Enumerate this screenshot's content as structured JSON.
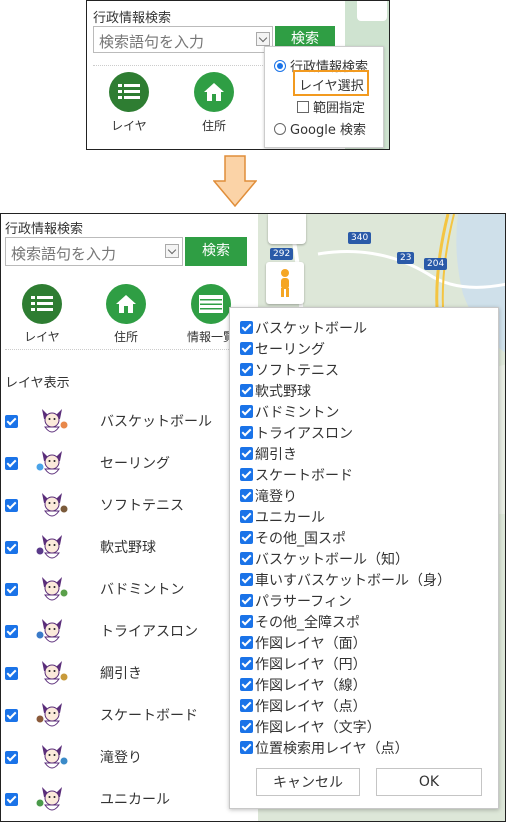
{
  "top_panel": {
    "title": "行政情報検索",
    "search_placeholder": "検索語句を入力",
    "search_button": "検索",
    "icons": [
      {
        "label": "レイヤ",
        "icon": "list-icon"
      },
      {
        "label": "住所",
        "icon": "home-icon"
      }
    ],
    "popup": {
      "options": [
        {
          "label": "行政情報検索",
          "checked": true
        },
        {
          "label": "レイヤ選択",
          "highlighted": true
        },
        {
          "label": "範囲指定",
          "type": "checkbox",
          "checked": false
        },
        {
          "label": "Google 検索",
          "checked": false
        }
      ]
    }
  },
  "bottom_panel": {
    "title": "行政情報検索",
    "search_placeholder": "検索語句を入力",
    "search_button": "検索",
    "icons": [
      {
        "label": "レイヤ",
        "icon": "list-icon"
      },
      {
        "label": "住所",
        "icon": "home-icon"
      },
      {
        "label": "情報一覧",
        "icon": "table-icon"
      }
    ],
    "layer_heading": "レイヤ表示",
    "layers": [
      {
        "label": "バスケットボール",
        "checked": true
      },
      {
        "label": "セーリング",
        "checked": true
      },
      {
        "label": "ソフトテニス",
        "checked": true
      },
      {
        "label": "軟式野球",
        "checked": true
      },
      {
        "label": "バドミントン",
        "checked": true
      },
      {
        "label": "トライアスロン",
        "checked": true
      },
      {
        "label": "綱引き",
        "checked": true
      },
      {
        "label": "スケートボード",
        "checked": true
      },
      {
        "label": "滝登り",
        "checked": true
      },
      {
        "label": "ユニカール",
        "checked": true
      }
    ],
    "map": {
      "road_labels": [
        "340",
        "292",
        "23",
        "204"
      ]
    },
    "dialog": {
      "items": [
        {
          "label": "バスケットボール",
          "checked": true
        },
        {
          "label": "セーリング",
          "checked": true
        },
        {
          "label": "ソフトテニス",
          "checked": true
        },
        {
          "label": "軟式野球",
          "checked": true
        },
        {
          "label": "バドミントン",
          "checked": true
        },
        {
          "label": "トライアスロン",
          "checked": true
        },
        {
          "label": "綱引き",
          "checked": true
        },
        {
          "label": "スケートボード",
          "checked": true
        },
        {
          "label": "滝登り",
          "checked": true
        },
        {
          "label": "ユニカール",
          "checked": true
        },
        {
          "label": "その他_国スポ",
          "checked": true
        },
        {
          "label": "バスケットボール（知）",
          "checked": true
        },
        {
          "label": "車いすバスケットボール（身）",
          "checked": true
        },
        {
          "label": "パラサーフィン",
          "checked": true
        },
        {
          "label": "その他_全障スポ",
          "checked": true
        },
        {
          "label": "作図レイヤ（面）",
          "checked": true
        },
        {
          "label": "作図レイヤ（円）",
          "checked": true
        },
        {
          "label": "作図レイヤ（線）",
          "checked": true
        },
        {
          "label": "作図レイヤ（点）",
          "checked": true
        },
        {
          "label": "作図レイヤ（文字）",
          "checked": true
        },
        {
          "label": "位置検索用レイヤ（点）",
          "checked": true
        }
      ],
      "cancel_button": "キャンセル",
      "ok_button": "OK"
    }
  },
  "colors": {
    "accent_green": "#2f9e44",
    "icon_green": "#2e7d32",
    "checkbox_blue": "#1a73e8",
    "highlight_orange": "#f29a1f",
    "arrow_fill": "#fbd3a7",
    "arrow_stroke": "#e08e3a"
  }
}
